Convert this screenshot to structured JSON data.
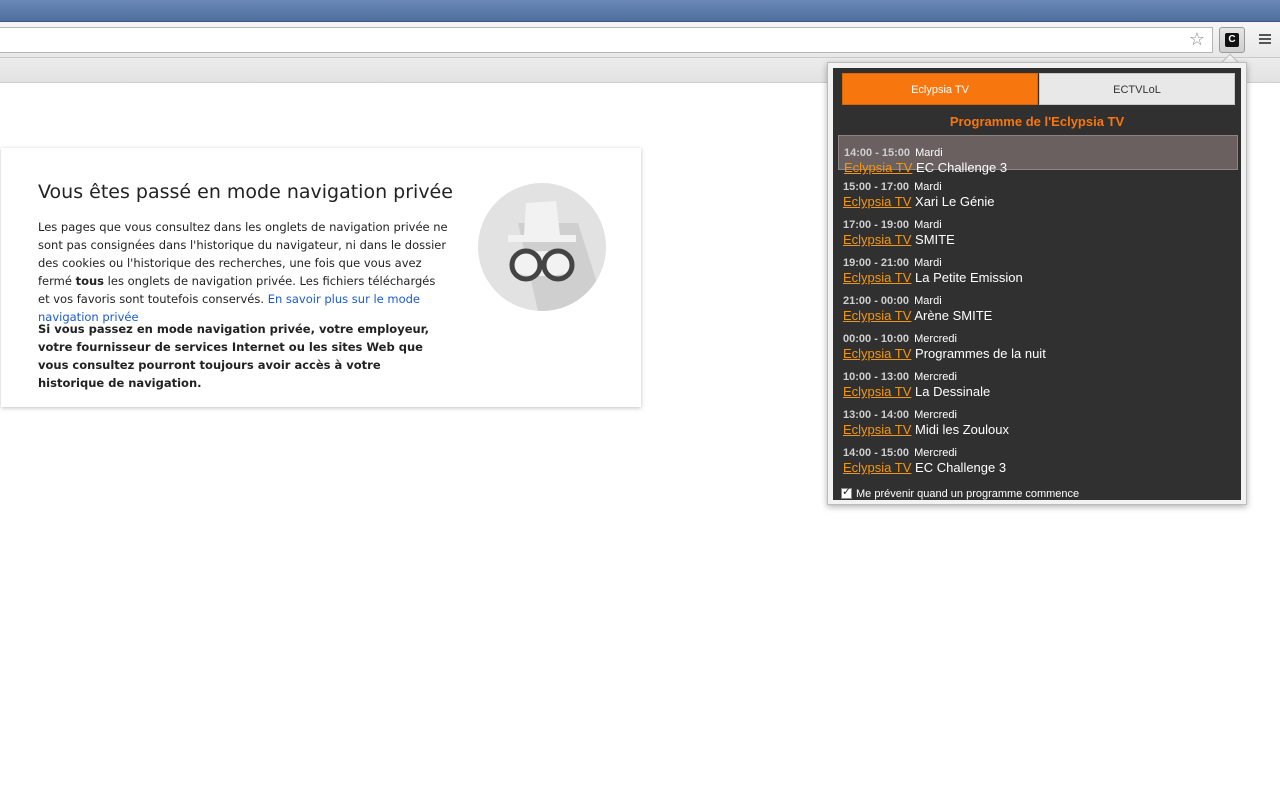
{
  "browser": {
    "star_icon": "star-outline-icon",
    "extension_icon": "eclypsia-extension-icon",
    "extension_logo_letter": "C",
    "menu_icon": "hamburger-menu-icon"
  },
  "incognito": {
    "title": "Vous êtes passé en mode navigation privée",
    "body_part1": "Les pages que vous consultez dans les onglets de navigation privée ne sont pas consignées dans l'historique du navigateur, ni dans le dossier des cookies ou l'historique des recherches, une fois que vous avez fermé ",
    "body_bold": "tous",
    "body_part2": " les onglets de navigation privée. Les fichiers téléchargés et vos favoris sont toutefois conservés. ",
    "learn_more_link": "En savoir plus sur le mode navigation privée",
    "warning": "Si vous passez en mode navigation privée, votre employeur, votre fournisseur de services Internet ou les sites Web que vous consultez pourront toujours avoir accès à votre historique de navigation.",
    "logo_icon": "incognito-spy-icon"
  },
  "popup": {
    "tabs": [
      {
        "label": "Eclypsia TV",
        "active": true
      },
      {
        "label": "ECTVLoL",
        "active": false
      }
    ],
    "heading": "Programme de l'Eclypsia TV",
    "programs": [
      {
        "time": "14:00 - 15:00",
        "day": "Mardi",
        "channel": "Eclypsia TV",
        "name": "EC Challenge 3",
        "current": true
      },
      {
        "time": "15:00 - 17:00",
        "day": "Mardi",
        "channel": "Eclypsia TV",
        "name": "Xari Le Génie",
        "current": false
      },
      {
        "time": "17:00 - 19:00",
        "day": "Mardi",
        "channel": "Eclypsia TV",
        "name": "SMITE",
        "current": false
      },
      {
        "time": "19:00 - 21:00",
        "day": "Mardi",
        "channel": "Eclypsia TV",
        "name": "La Petite Emission",
        "current": false
      },
      {
        "time": "21:00 - 00:00",
        "day": "Mardi",
        "channel": "Eclypsia TV",
        "name": "Arène SMITE",
        "current": false
      },
      {
        "time": "00:00 - 10:00",
        "day": "Mercredi",
        "channel": "Eclypsia TV",
        "name": "Programmes de la nuit",
        "current": false
      },
      {
        "time": "10:00 - 13:00",
        "day": "Mercredi",
        "channel": "Eclypsia TV",
        "name": "La Dessinale",
        "current": false
      },
      {
        "time": "13:00 - 14:00",
        "day": "Mercredi",
        "channel": "Eclypsia TV",
        "name": "Midi les Zouloux",
        "current": false
      },
      {
        "time": "14:00 - 15:00",
        "day": "Mercredi",
        "channel": "Eclypsia TV",
        "name": "EC Challenge 3",
        "current": false
      }
    ],
    "notify_label": "Me prévenir quand un programme commence",
    "notify_checked": true
  },
  "colors": {
    "accent": "#f7760d",
    "popup_bg": "#303030",
    "link": "#1a5bd1"
  }
}
